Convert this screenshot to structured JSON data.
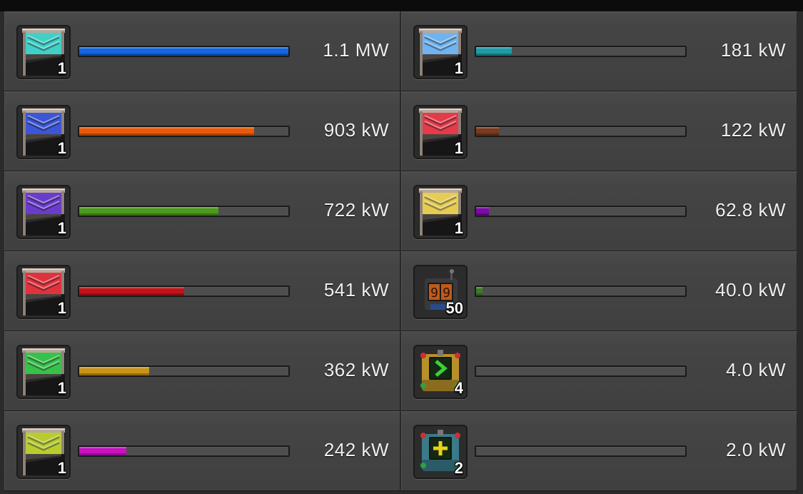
{
  "rows": [
    {
      "icon": "cyan-flag-icon",
      "icon_color": "#3fd0c8",
      "count": "1",
      "bar_color": "#1466e0",
      "fill_fraction": 1.0,
      "value": "1.1 MW"
    },
    {
      "icon": "light-blue-flag-icon",
      "icon_color": "#6fb4f0",
      "count": "1",
      "bar_color": "#1f9aa6",
      "fill_fraction": 0.17,
      "value": "181 kW"
    },
    {
      "icon": "blue-flag-icon",
      "icon_color": "#3c56d6",
      "count": "1",
      "bar_color": "#e85a0a",
      "fill_fraction": 0.835,
      "value": "903 kW"
    },
    {
      "icon": "red-flag-icon",
      "icon_color": "#e43a4a",
      "count": "1",
      "bar_color": "#7a3a1e",
      "fill_fraction": 0.11,
      "value": "122 kW"
    },
    {
      "icon": "purple-flag-icon",
      "icon_color": "#6a3ccc",
      "count": "1",
      "bar_color": "#4c9a1e",
      "fill_fraction": 0.665,
      "value": "722 kW"
    },
    {
      "icon": "yellow-flag-icon",
      "icon_color": "#e6cc52",
      "count": "1",
      "bar_color": "#7c0aa6",
      "fill_fraction": 0.06,
      "value": "62.8 kW"
    },
    {
      "icon": "red-flag-icon",
      "icon_color": "#e0323e",
      "count": "1",
      "bar_color": "#c0141c",
      "fill_fraction": 0.5,
      "value": "541 kW"
    },
    {
      "icon": "counter-machine-icon",
      "icon_color": "#c05a1a",
      "count": "50",
      "bar_color": "#3c7a2a",
      "fill_fraction": 0.03,
      "value": "40.0 kW"
    },
    {
      "icon": "green-flag-icon",
      "icon_color": "#36c24a",
      "count": "1",
      "bar_color": "#c89418",
      "fill_fraction": 0.335,
      "value": "362 kW"
    },
    {
      "icon": "arrow-combinator-icon",
      "icon_color": "#3ad23a",
      "count": "4",
      "bar_color": "#555555",
      "fill_fraction": 0.0,
      "value": "4.0 kW"
    },
    {
      "icon": "lime-flag-icon",
      "icon_color": "#b8cc30",
      "count": "1",
      "bar_color": "#c812c0",
      "fill_fraction": 0.225,
      "value": "242 kW"
    },
    {
      "icon": "plus-combinator-icon",
      "icon_color": "#e8d21a",
      "count": "2",
      "bar_color": "#555555",
      "fill_fraction": 0.0,
      "value": "2.0 kW"
    }
  ]
}
